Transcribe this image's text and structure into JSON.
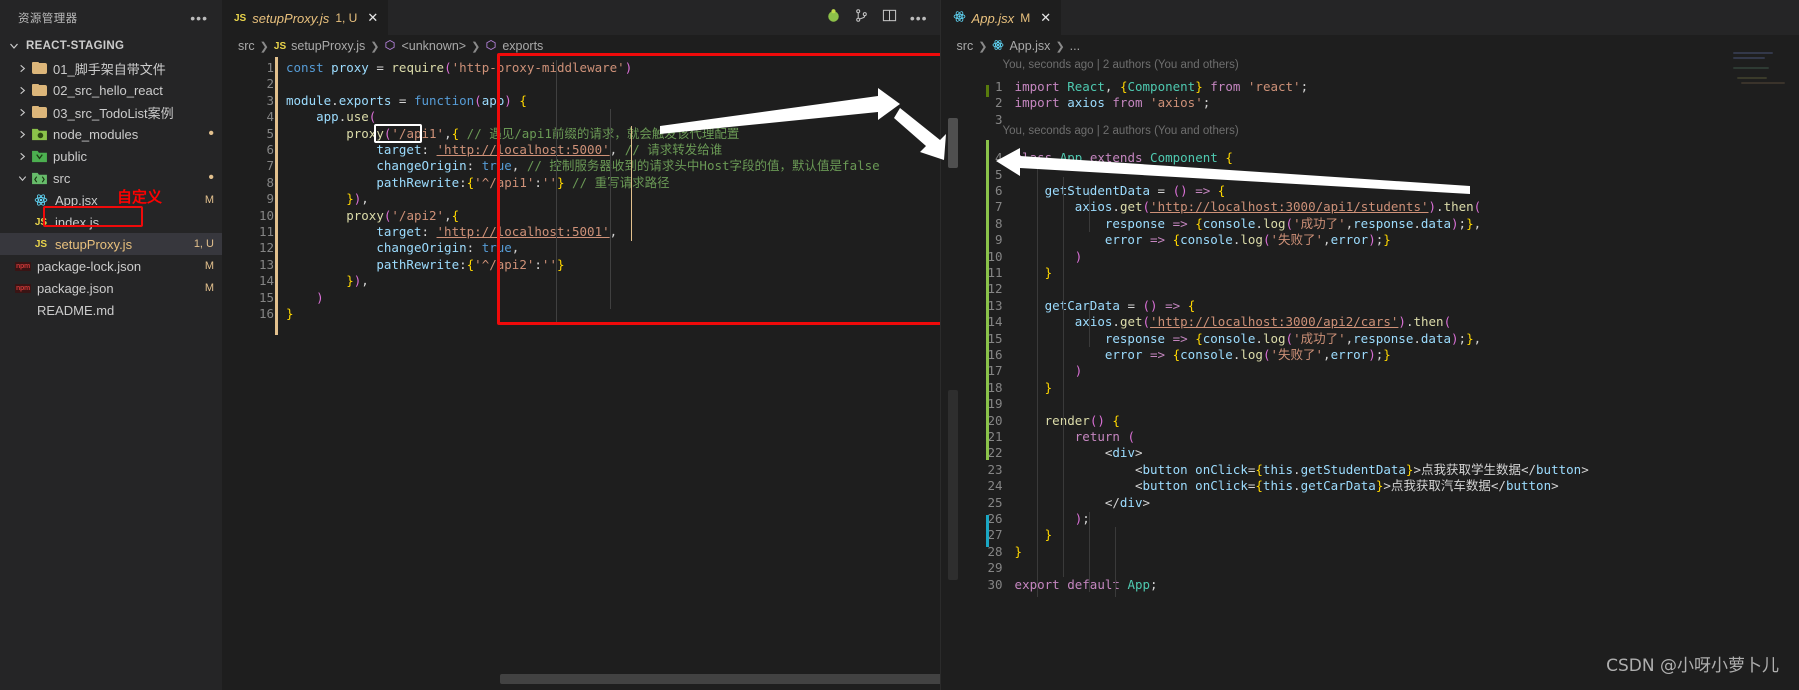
{
  "sidebar": {
    "title": "资源管理器",
    "more_icon": "ellipsis-icon",
    "project": "REACT-STAGING",
    "items": [
      {
        "label": "01_脚手架自带文件",
        "icon": "folder-icon",
        "badge": "",
        "depth": 1,
        "arrow": "chevron-right"
      },
      {
        "label": "02_src_hello_react",
        "icon": "folder-icon",
        "badge": "",
        "depth": 1,
        "arrow": "chevron-right"
      },
      {
        "label": "03_src_TodoList案例",
        "icon": "folder-icon",
        "badge": "",
        "depth": 1,
        "arrow": "chevron-right"
      },
      {
        "label": "node_modules",
        "icon": "node-folder-icon",
        "badge": "dot",
        "depth": 1,
        "arrow": "chevron-right"
      },
      {
        "label": "public",
        "icon": "public-folder-icon",
        "badge": "",
        "depth": 1,
        "arrow": "chevron-right"
      },
      {
        "label": "src",
        "icon": "src-folder-icon",
        "badge": "dot",
        "depth": 1,
        "arrow": "chevron-down"
      },
      {
        "label": "App.jsx",
        "icon": "react-icon",
        "badge": "M",
        "depth": 2,
        "arrow": ""
      },
      {
        "label": "index.js",
        "icon": "js-icon",
        "badge": "",
        "depth": 2,
        "arrow": ""
      },
      {
        "label": "setupProxy.js",
        "icon": "js-icon",
        "badge": "1, U",
        "depth": 2,
        "arrow": "",
        "selected": true,
        "highlighted": true
      },
      {
        "label": "package-lock.json",
        "icon": "npm-icon",
        "badge": "M",
        "depth": 1,
        "arrow": ""
      },
      {
        "label": "package.json",
        "icon": "npm-icon",
        "badge": "M",
        "depth": 1,
        "arrow": ""
      },
      {
        "label": "README.md",
        "icon": "markdown-icon",
        "badge": "",
        "depth": 1,
        "arrow": ""
      }
    ],
    "annotation": "自定义"
  },
  "left_editor": {
    "tab": {
      "icon": "js-icon",
      "name": "setupProxy.js",
      "status": "1, U",
      "close": "✕"
    },
    "actions": [
      "split-editor-icon",
      "more-actions-icon"
    ],
    "breadcrumb": [
      "src",
      "setupProxy.js",
      "<unknown>",
      "exports"
    ],
    "breadcrumb_icons": [
      "",
      "js-icon",
      "symbol-icon",
      "symbol-icon"
    ],
    "line_count": 16,
    "lines": [
      "const proxy = require('http-proxy-middleware')",
      "",
      "module.exports = function(app) {",
      "    app.use(",
      "        proxy('/api1',{ // 遇见/api1前缀的请求，就会触发该代理配置",
      "            target: 'http://localhost:5000', // 请求转发给谁",
      "            changeOrigin: true, // 控制服务器收到的请求头中Host字段的值，默认值是false",
      "            pathRewrite:{'^/api1':''} // 重写请求路径",
      "        }),",
      "        proxy('/api2',{",
      "            target: 'http://localhost:5001',",
      "            changeOrigin: true,",
      "            pathRewrite:{'^/api2':''}",
      "        }),",
      "    )",
      "}"
    ],
    "highlight_token": "'/api1'"
  },
  "right_editor": {
    "tab": {
      "icon": "react-icon",
      "name": "App.jsx",
      "status": "M",
      "close": "✕"
    },
    "breadcrumb": [
      "src",
      "App.jsx",
      "..."
    ],
    "blame_1": "You, seconds ago | 2 authors (You and others)",
    "blame_2": "You, seconds ago | 2 authors (You and others)",
    "line_count": 30,
    "lines": [
      "import React, {Component} from 'react';",
      "import axios from 'axios';",
      "",
      "class App extends Component {",
      "",
      "    getStudentData = () => {",
      "        axios.get('http://localhost:3000/api1/students').then(",
      "            response => {console.log('成功了',response.data);},",
      "            error => {console.log('失败了',error);}",
      "        )",
      "    }",
      "",
      "    getCarData = () => {",
      "        axios.get('http://localhost:3000/api2/cars').then(",
      "            response => {console.log('成功了',response.data);},",
      "            error => {console.log('失败了',error);}",
      "        )",
      "    }",
      "",
      "    render() {",
      "        return (",
      "            <div>",
      "                <button onClick={this.getStudentData}>点我获取学生数据</button>",
      "                <button onClick={this.getCarData}>点我获取汽车数据</button>",
      "            </div>",
      "        );",
      "    }",
      "}",
      "",
      "export default App;"
    ],
    "highlight_token": "api1"
  },
  "watermark": "CSDN @小呀小萝卜儿",
  "colors": {
    "accent_red": "#f00a0a",
    "sidebar_bg": "#252526",
    "editor_bg": "#1e1e1e",
    "selected_row": "#37373d",
    "string": "#ce9178",
    "keyword": "#569cd6",
    "comment": "#6a9955"
  }
}
